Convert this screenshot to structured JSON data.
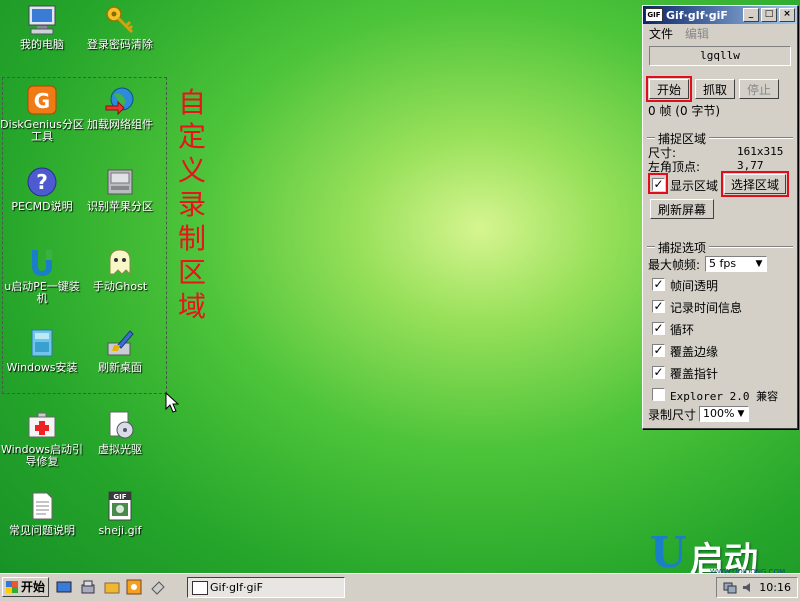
{
  "desktop": {
    "icons": [
      {
        "label": "我的电脑",
        "icon": "computer-icon"
      },
      {
        "label": "登录密码清除",
        "icon": "key-icon"
      },
      {
        "label": "DiskGenius分区工具",
        "icon": "diskgenius-icon"
      },
      {
        "label": "加载网络组件",
        "icon": "globe-icon"
      },
      {
        "label": "PECMD说明",
        "icon": "help-icon"
      },
      {
        "label": "识别苹果分区",
        "icon": "drive-icon"
      },
      {
        "label": "u启动PE一键装机",
        "icon": "u-logo-icon"
      },
      {
        "label": "手动Ghost",
        "icon": "ghost-icon"
      },
      {
        "label": "Windows安装",
        "icon": "windows-install-icon"
      },
      {
        "label": "刷新桌面",
        "icon": "brush-icon"
      },
      {
        "label": "Windows启动引导修复",
        "icon": "first-aid-icon"
      },
      {
        "label": "虚拟光驱",
        "icon": "virtual-drive-icon"
      },
      {
        "label": "常见问题说明",
        "icon": "document-icon"
      },
      {
        "label": "sheji.gif",
        "icon": "gif-file-icon"
      }
    ],
    "annotation": "自定义录制区域"
  },
  "gif_window": {
    "title": "Gif·gIf·giF",
    "menu": [
      "文件",
      "编辑"
    ],
    "filename": "lgqllw",
    "buttons": {
      "start": "开始",
      "grab": "抓取",
      "stop": "停止"
    },
    "frames_status": "0 帧 (0 字节)",
    "capture_area": {
      "heading": "捕捉区域",
      "size_label": "尺寸:",
      "size_value": "161x315",
      "origin_label": "左角顶点:",
      "origin_value": "3,77",
      "show_area_label": "显示区域",
      "show_area_checked": true,
      "select_area_button": "选择区域",
      "refresh_button": "刷新屏幕"
    },
    "capture_options": {
      "heading": "捕捉选项",
      "max_fps_label": "最大帧频:",
      "max_fps_value": "5 fps",
      "options": [
        {
          "label": "帧间透明",
          "checked": true
        },
        {
          "label": "记录时间信息",
          "checked": true
        },
        {
          "label": "循环",
          "checked": true
        },
        {
          "label": "覆盖边缘",
          "checked": true
        },
        {
          "label": "覆盖指针",
          "checked": true
        },
        {
          "label": "Explorer 2.0 兼容",
          "checked": false
        }
      ],
      "record_size_label": "录制尺寸",
      "record_size_value": "100%"
    }
  },
  "logo": {
    "text": "启动",
    "sub": "WWW.UQIDONG.COM"
  },
  "taskbar": {
    "start_label": "开始",
    "task_label": "Gif·gIf·giF",
    "clock": "10:16"
  },
  "colors": {
    "annotation_red": "#e8131b",
    "highlight_red": "#e20d1a",
    "title_blue": "#0a246a"
  }
}
